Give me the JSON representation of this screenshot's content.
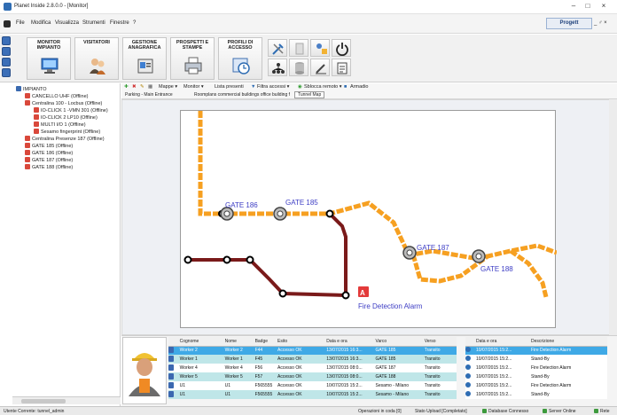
{
  "window": {
    "title": "Planet Inside 2.8.0.0 - [Monitor]",
    "controls": [
      "–",
      "□",
      "×"
    ]
  },
  "menu": {
    "items": [
      "File",
      "Modifica",
      "Visualizza",
      "Strumenti",
      "Finestre",
      "?"
    ],
    "brand": "Progett",
    "window_ctrl": "_ ♂ ×"
  },
  "toolbar": {
    "buttons": [
      {
        "label": "MONITOR\nIMPIANTO",
        "icon": "monitor-icon"
      },
      {
        "label": "VISITATORI",
        "icon": "visitors-icon"
      },
      {
        "label": "GESTIONE\nANAGRAFICA",
        "icon": "registry-icon"
      },
      {
        "label": "PROSPETTI E\nSTAMPE",
        "icon": "printer-icon"
      },
      {
        "label": "PROFILI DI\nACCESSO",
        "icon": "access-clock-icon"
      }
    ]
  },
  "tree": {
    "nodes": [
      {
        "label": "IMPIANTO",
        "level": 0
      },
      {
        "label": "CANCELLO UHF (Offline)",
        "level": 1
      },
      {
        "label": "Centralina 100 - Locbus (Offline)",
        "level": 1
      },
      {
        "label": "IO-CLICK 1 -VMN 301 (Offline)",
        "level": 2
      },
      {
        "label": "IO-CLICK 2 LP10 (Offline)",
        "level": 2
      },
      {
        "label": "MULTI I/O 1 (Offline)",
        "level": 2
      },
      {
        "label": "Sesamo fingerprint (Offline)",
        "level": 2
      },
      {
        "label": "Centralina Presenze 187 (Offline)",
        "level": 1
      },
      {
        "label": "GATE 185 (Offline)",
        "level": 1
      },
      {
        "label": "GATE 186 (Offline)",
        "level": 1
      },
      {
        "label": "GATE 187 (Offline)",
        "level": 1
      },
      {
        "label": "GATE 188 (Offline)",
        "level": 1
      }
    ]
  },
  "toolbar2": {
    "items": [
      "Mappe ▾",
      "Monitor ▾",
      "Lista presenti",
      "Filtra accessi ▾",
      "Sblocca remoto ▾",
      "Armadio"
    ]
  },
  "breadcrumb": {
    "parts": [
      "Parking - Main Entrance",
      "Roomplans commercial buildings office building f",
      "Tunnel Map"
    ]
  },
  "map": {
    "gates": [
      {
        "label": "GATE 186"
      },
      {
        "label": "GATE 185"
      },
      {
        "label": "GATE 187"
      },
      {
        "label": "GATE 188"
      }
    ],
    "alarm": {
      "label": "Fire Detection Alarm"
    },
    "colors": {
      "tunnel_orange": "#f6a021",
      "tunnel_dark": "#7a1a1a",
      "gate_label": "#3d3dc4",
      "alarm": "#e33a3a"
    }
  },
  "grid": {
    "columns": [
      "Cognome",
      "Nome",
      "Badge",
      "Esito",
      "Data e ora",
      "Varco",
      "Verso"
    ],
    "rows": [
      [
        "Worker 2",
        "Worker 2",
        "F44",
        "Accesso OK",
        "13/07/2015 16:3...",
        "GATE 185",
        "Transito"
      ],
      [
        "Worker 1",
        "Worker 1",
        "F45",
        "Accesso OK",
        "13/07/2015 16:3...",
        "GATE 185",
        "Transito"
      ],
      [
        "Worker 4",
        "Worker 4",
        "F56",
        "Accesso OK",
        "13/07/2015 08:0...",
        "GATE 187",
        "Transito"
      ],
      [
        "Worker 5",
        "Worker 5",
        "F57",
        "Accesso OK",
        "13/07/2015 08:0...",
        "GATE 188",
        "Transito"
      ],
      [
        "U1",
        "U1",
        "F565555",
        "Accesso OK",
        "10/07/2015 15:2...",
        "Sesamo - Milano",
        "Transito"
      ],
      [
        "U1",
        "U1",
        "F565555",
        "Accesso OK",
        "10/07/2015 15:2...",
        "Sesamo - Milano",
        "Transito"
      ]
    ]
  },
  "events": {
    "columns": [
      "Data e ora",
      "Descrizione"
    ],
    "rows": [
      [
        "10/07/2015 15:2...",
        "Fire Detection Alarm"
      ],
      [
        "10/07/2015 15:2...",
        "Stand-By"
      ],
      [
        "10/07/2015 15:2...",
        "Fire Detection Alarm"
      ],
      [
        "10/07/2015 15:2...",
        "Stand-By"
      ],
      [
        "10/07/2015 15:2...",
        "Fire Detection Alarm"
      ],
      [
        "10/07/2015 15:2...",
        "Stand-By"
      ]
    ]
  },
  "status": {
    "user": "Utente Corrente: tunnel_admin",
    "queue": "Operazioni in coda [0]",
    "upload": "Stato Upload [Completato]",
    "database": "Database Connesso",
    "server": "Server Online",
    "rete": "Rete"
  }
}
